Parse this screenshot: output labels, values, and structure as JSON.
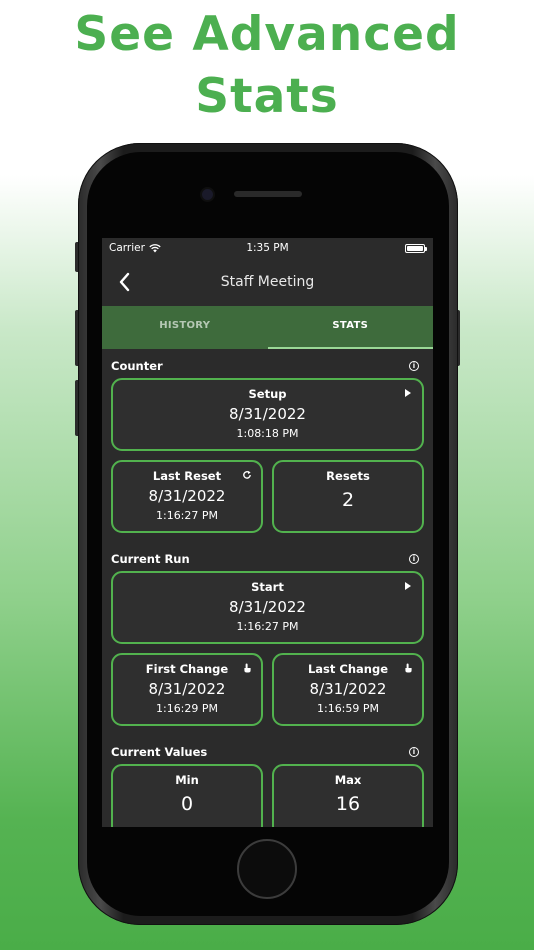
{
  "headline": {
    "line1": "See Advanced",
    "line2": "Stats"
  },
  "status_bar": {
    "carrier": "Carrier",
    "time": "1:35 PM"
  },
  "nav": {
    "title": "Staff Meeting"
  },
  "tabs": [
    {
      "label": "HISTORY",
      "active": false
    },
    {
      "label": "STATS",
      "active": true
    }
  ],
  "sections": {
    "counter": {
      "title": "Counter",
      "setup": {
        "label": "Setup",
        "date": "8/31/2022",
        "time": "1:08:18 PM"
      },
      "last_reset": {
        "label": "Last Reset",
        "date": "8/31/2022",
        "time": "1:16:27 PM"
      },
      "resets": {
        "label": "Resets",
        "value": "2"
      }
    },
    "current_run": {
      "title": "Current Run",
      "start": {
        "label": "Start",
        "date": "8/31/2022",
        "time": "1:16:27 PM"
      },
      "first_change": {
        "label": "First Change",
        "date": "8/31/2022",
        "time": "1:16:29 PM"
      },
      "last_change": {
        "label": "Last Change",
        "date": "8/31/2022",
        "time": "1:16:59 PM"
      }
    },
    "current_values": {
      "title": "Current Values",
      "min": {
        "label": "Min",
        "value": "0"
      },
      "max": {
        "label": "Max",
        "value": "16"
      }
    }
  },
  "colors": {
    "accent": "#4caf50",
    "card_border": "#52b24e",
    "tab_bar": "#3e6b3c",
    "screen_bg": "#2b2b2b"
  },
  "icons": {
    "back": "chevron-left-icon",
    "play": "play-icon",
    "reset": "refresh-icon",
    "touch": "hand-tap-icon",
    "info": "info-icon",
    "wifi": "wifi-icon",
    "battery": "battery-icon"
  }
}
